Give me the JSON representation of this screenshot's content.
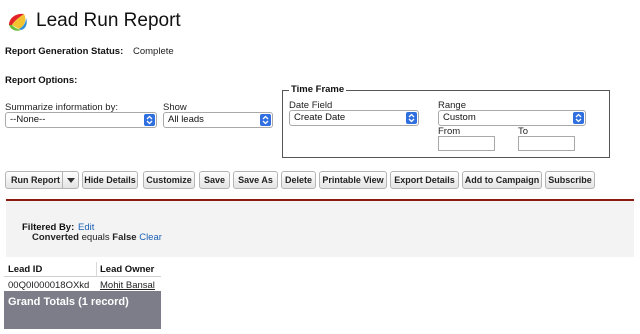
{
  "header": {
    "title": "Lead Run Report"
  },
  "status": {
    "label": "Report Generation Status:",
    "value": "Complete"
  },
  "options": {
    "label": "Report Options:",
    "summarize": {
      "label": "Summarize information by:",
      "value": "--None--"
    },
    "show": {
      "label": "Show",
      "value": "All leads"
    }
  },
  "time_frame": {
    "legend": "Time Frame",
    "date_field": {
      "label": "Date Field",
      "value": "Create Date"
    },
    "range": {
      "label": "Range",
      "value": "Custom"
    },
    "from_label": "From",
    "to_label": "To",
    "from_value": "",
    "to_value": ""
  },
  "toolbar": {
    "run_report": "Run Report",
    "hide_details": "Hide Details",
    "customize": "Customize",
    "save": "Save",
    "save_as": "Save As",
    "delete": "Delete",
    "printable_view": "Printable View",
    "export_details": "Export Details",
    "add_to_campaign": "Add to Campaign",
    "subscribe": "Subscribe"
  },
  "filter": {
    "filtered_by": "Filtered By:",
    "edit": "Edit",
    "condition_field": "Converted",
    "condition_op": "equals",
    "condition_value": "False",
    "clear": "Clear"
  },
  "table": {
    "columns": [
      "Lead ID",
      "Lead Owner"
    ],
    "rows": [
      [
        "00Q0I000018OXkd",
        "Mohit Bansal"
      ]
    ],
    "grand_totals": "Grand Totals (1 record)"
  },
  "colors": {
    "accent": "#2f6fe0",
    "divider": "#8b1a10",
    "totals_bg": "#7d7d8a",
    "link": "#1a5fb4"
  }
}
